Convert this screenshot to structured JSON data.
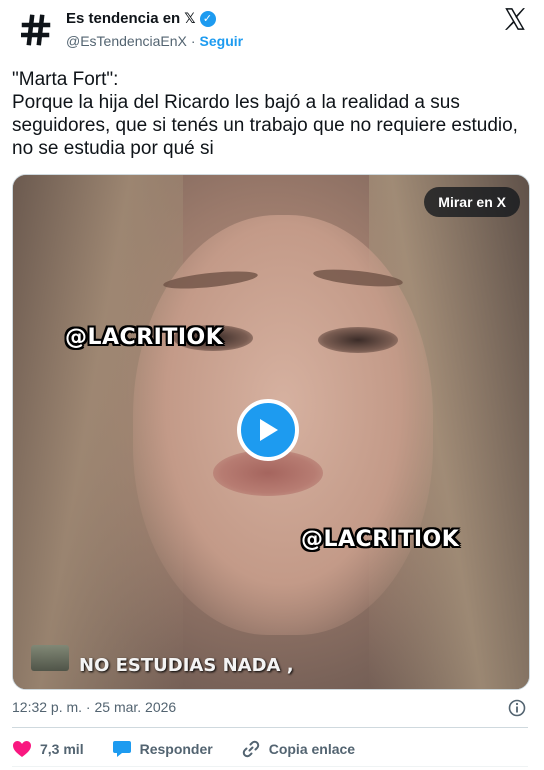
{
  "header": {
    "display_name": "Es tendencia en",
    "name_suffix": "𝕏",
    "verified": "✓",
    "handle": "@EsTendenciaEnX",
    "separator": "·",
    "follow_label": "Seguir",
    "avatar_icon": "hashtag-icon",
    "platform_icon": "x-logo-icon"
  },
  "tweet": {
    "text": "\"Marta Fort\":\nPorque la hija del Ricardo les bajó a la realidad a sus seguidores, que si tenés un trabajo que no requiere estudio, no se estudia por qué si"
  },
  "media": {
    "watch_label": "Mirar en X",
    "watermark_1": "@LACRITIOK",
    "watermark_2": "@LACRITIOK",
    "caption": "NO ESTUDIAS NADA ,",
    "play_icon": "play-icon"
  },
  "meta": {
    "timestamp": "12:32 p. m. · 25 mar. 2026",
    "info_icon": "info-icon"
  },
  "actions": {
    "like_count": "7,3 mil",
    "reply_label": "Responder",
    "copy_label": "Copia enlace"
  },
  "colors": {
    "accent": "#1d9bf0",
    "like": "#f91880",
    "text": "#0f1419",
    "secondary": "#536471"
  }
}
